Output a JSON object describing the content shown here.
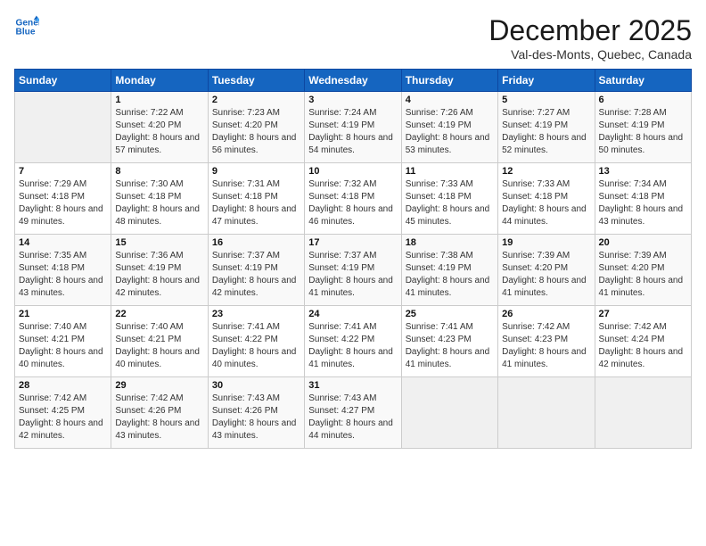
{
  "header": {
    "logo_line1": "General",
    "logo_line2": "Blue",
    "month": "December 2025",
    "location": "Val-des-Monts, Quebec, Canada"
  },
  "weekdays": [
    "Sunday",
    "Monday",
    "Tuesday",
    "Wednesday",
    "Thursday",
    "Friday",
    "Saturday"
  ],
  "weeks": [
    [
      {
        "day": "",
        "sunrise": "",
        "sunset": "",
        "daylight": ""
      },
      {
        "day": "1",
        "sunrise": "Sunrise: 7:22 AM",
        "sunset": "Sunset: 4:20 PM",
        "daylight": "Daylight: 8 hours and 57 minutes."
      },
      {
        "day": "2",
        "sunrise": "Sunrise: 7:23 AM",
        "sunset": "Sunset: 4:20 PM",
        "daylight": "Daylight: 8 hours and 56 minutes."
      },
      {
        "day": "3",
        "sunrise": "Sunrise: 7:24 AM",
        "sunset": "Sunset: 4:19 PM",
        "daylight": "Daylight: 8 hours and 54 minutes."
      },
      {
        "day": "4",
        "sunrise": "Sunrise: 7:26 AM",
        "sunset": "Sunset: 4:19 PM",
        "daylight": "Daylight: 8 hours and 53 minutes."
      },
      {
        "day": "5",
        "sunrise": "Sunrise: 7:27 AM",
        "sunset": "Sunset: 4:19 PM",
        "daylight": "Daylight: 8 hours and 52 minutes."
      },
      {
        "day": "6",
        "sunrise": "Sunrise: 7:28 AM",
        "sunset": "Sunset: 4:19 PM",
        "daylight": "Daylight: 8 hours and 50 minutes."
      }
    ],
    [
      {
        "day": "7",
        "sunrise": "Sunrise: 7:29 AM",
        "sunset": "Sunset: 4:18 PM",
        "daylight": "Daylight: 8 hours and 49 minutes."
      },
      {
        "day": "8",
        "sunrise": "Sunrise: 7:30 AM",
        "sunset": "Sunset: 4:18 PM",
        "daylight": "Daylight: 8 hours and 48 minutes."
      },
      {
        "day": "9",
        "sunrise": "Sunrise: 7:31 AM",
        "sunset": "Sunset: 4:18 PM",
        "daylight": "Daylight: 8 hours and 47 minutes."
      },
      {
        "day": "10",
        "sunrise": "Sunrise: 7:32 AM",
        "sunset": "Sunset: 4:18 PM",
        "daylight": "Daylight: 8 hours and 46 minutes."
      },
      {
        "day": "11",
        "sunrise": "Sunrise: 7:33 AM",
        "sunset": "Sunset: 4:18 PM",
        "daylight": "Daylight: 8 hours and 45 minutes."
      },
      {
        "day": "12",
        "sunrise": "Sunrise: 7:33 AM",
        "sunset": "Sunset: 4:18 PM",
        "daylight": "Daylight: 8 hours and 44 minutes."
      },
      {
        "day": "13",
        "sunrise": "Sunrise: 7:34 AM",
        "sunset": "Sunset: 4:18 PM",
        "daylight": "Daylight: 8 hours and 43 minutes."
      }
    ],
    [
      {
        "day": "14",
        "sunrise": "Sunrise: 7:35 AM",
        "sunset": "Sunset: 4:18 PM",
        "daylight": "Daylight: 8 hours and 43 minutes."
      },
      {
        "day": "15",
        "sunrise": "Sunrise: 7:36 AM",
        "sunset": "Sunset: 4:19 PM",
        "daylight": "Daylight: 8 hours and 42 minutes."
      },
      {
        "day": "16",
        "sunrise": "Sunrise: 7:37 AM",
        "sunset": "Sunset: 4:19 PM",
        "daylight": "Daylight: 8 hours and 42 minutes."
      },
      {
        "day": "17",
        "sunrise": "Sunrise: 7:37 AM",
        "sunset": "Sunset: 4:19 PM",
        "daylight": "Daylight: 8 hours and 41 minutes."
      },
      {
        "day": "18",
        "sunrise": "Sunrise: 7:38 AM",
        "sunset": "Sunset: 4:19 PM",
        "daylight": "Daylight: 8 hours and 41 minutes."
      },
      {
        "day": "19",
        "sunrise": "Sunrise: 7:39 AM",
        "sunset": "Sunset: 4:20 PM",
        "daylight": "Daylight: 8 hours and 41 minutes."
      },
      {
        "day": "20",
        "sunrise": "Sunrise: 7:39 AM",
        "sunset": "Sunset: 4:20 PM",
        "daylight": "Daylight: 8 hours and 41 minutes."
      }
    ],
    [
      {
        "day": "21",
        "sunrise": "Sunrise: 7:40 AM",
        "sunset": "Sunset: 4:21 PM",
        "daylight": "Daylight: 8 hours and 40 minutes."
      },
      {
        "day": "22",
        "sunrise": "Sunrise: 7:40 AM",
        "sunset": "Sunset: 4:21 PM",
        "daylight": "Daylight: 8 hours and 40 minutes."
      },
      {
        "day": "23",
        "sunrise": "Sunrise: 7:41 AM",
        "sunset": "Sunset: 4:22 PM",
        "daylight": "Daylight: 8 hours and 40 minutes."
      },
      {
        "day": "24",
        "sunrise": "Sunrise: 7:41 AM",
        "sunset": "Sunset: 4:22 PM",
        "daylight": "Daylight: 8 hours and 41 minutes."
      },
      {
        "day": "25",
        "sunrise": "Sunrise: 7:41 AM",
        "sunset": "Sunset: 4:23 PM",
        "daylight": "Daylight: 8 hours and 41 minutes."
      },
      {
        "day": "26",
        "sunrise": "Sunrise: 7:42 AM",
        "sunset": "Sunset: 4:23 PM",
        "daylight": "Daylight: 8 hours and 41 minutes."
      },
      {
        "day": "27",
        "sunrise": "Sunrise: 7:42 AM",
        "sunset": "Sunset: 4:24 PM",
        "daylight": "Daylight: 8 hours and 42 minutes."
      }
    ],
    [
      {
        "day": "28",
        "sunrise": "Sunrise: 7:42 AM",
        "sunset": "Sunset: 4:25 PM",
        "daylight": "Daylight: 8 hours and 42 minutes."
      },
      {
        "day": "29",
        "sunrise": "Sunrise: 7:42 AM",
        "sunset": "Sunset: 4:26 PM",
        "daylight": "Daylight: 8 hours and 43 minutes."
      },
      {
        "day": "30",
        "sunrise": "Sunrise: 7:43 AM",
        "sunset": "Sunset: 4:26 PM",
        "daylight": "Daylight: 8 hours and 43 minutes."
      },
      {
        "day": "31",
        "sunrise": "Sunrise: 7:43 AM",
        "sunset": "Sunset: 4:27 PM",
        "daylight": "Daylight: 8 hours and 44 minutes."
      },
      {
        "day": "",
        "sunrise": "",
        "sunset": "",
        "daylight": ""
      },
      {
        "day": "",
        "sunrise": "",
        "sunset": "",
        "daylight": ""
      },
      {
        "day": "",
        "sunrise": "",
        "sunset": "",
        "daylight": ""
      }
    ]
  ]
}
